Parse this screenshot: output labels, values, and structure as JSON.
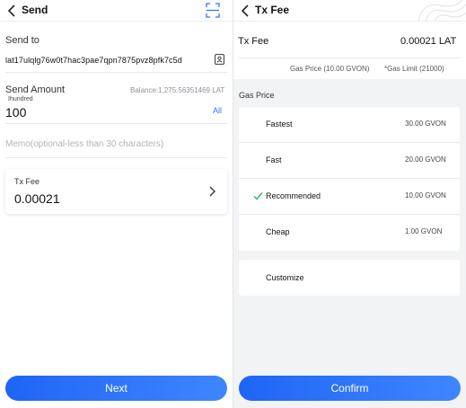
{
  "left": {
    "title": "Send",
    "send_to_label": "Send to",
    "address": "lat17ulqlg76w0t7hac3pae7qpn7875pvz8pfk7c5d",
    "send_amount_label": "Send Amount",
    "balance": "Balance:1,275.56351469 LAT",
    "hint": "Ihundred",
    "amount": "100",
    "all_label": "All",
    "memo_placeholder": "Memo(optional-less than 30 characters)",
    "fee_label": "Tx Fee",
    "fee_value": "0.00021",
    "next_label": "Next"
  },
  "right": {
    "title": "Tx Fee",
    "fee_label": "Tx Fee",
    "fee_value": "0.00021 LAT",
    "gas_price_info": "Gas Price  (10.00 GVON)",
    "gas_limit_info": "*Gas Limit  (21000)",
    "gas_price_label": "Gas Price",
    "options": [
      {
        "name": "Fastest",
        "price": "30.00 GVON",
        "selected": false
      },
      {
        "name": "Fast",
        "price": "20.00 GVON",
        "selected": false
      },
      {
        "name": "Recommended",
        "price": "10.00 GVON",
        "selected": true
      },
      {
        "name": "Cheap",
        "price": "1.00 GVON",
        "selected": false
      }
    ],
    "customize_label": "Customize",
    "confirm_label": "Confirm"
  },
  "colors": {
    "accent": "#2f73ff",
    "button_start": "#1f65f5",
    "button_end": "#3e86ff",
    "check": "#2bb56a",
    "panel_bg": "#f2f3f5"
  },
  "icons": [
    "back-arrow-icon",
    "scan-icon",
    "address-book-icon",
    "chevron-right-icon",
    "checkmark-icon"
  ]
}
